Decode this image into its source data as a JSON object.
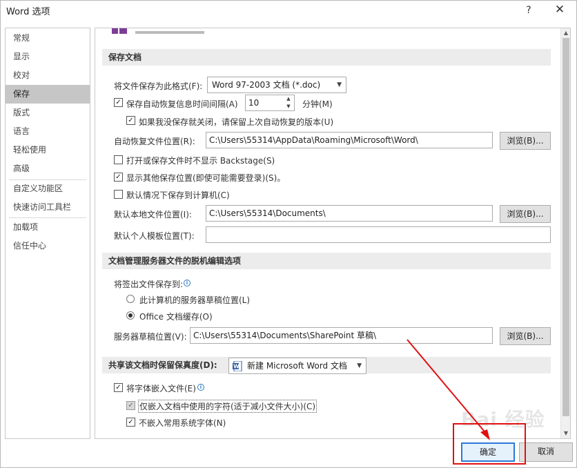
{
  "window": {
    "title": "Word 选项",
    "help_glyph": "?",
    "close_glyph": "✕"
  },
  "sidebar": {
    "items": [
      {
        "label": "常规"
      },
      {
        "label": "显示"
      },
      {
        "label": "校对"
      },
      {
        "label": "保存",
        "active": true
      },
      {
        "label": "版式"
      },
      {
        "label": "语言"
      },
      {
        "label": "轻松使用"
      },
      {
        "label": "高级"
      },
      {
        "label": "自定义功能区"
      },
      {
        "label": "快速访问工具栏"
      },
      {
        "label": "加载项"
      },
      {
        "label": "信任中心"
      }
    ]
  },
  "save_section": {
    "header": "保存文档",
    "format_label": "将文件保存为此格式(F):",
    "format_value": "Word 97-2003 文档 (*.doc)",
    "autorecover_label": "保存自动恢复信息时间间隔(A)",
    "autorecover_checked": true,
    "autorecover_value": "10",
    "minutes_label": "分钟(M)",
    "keep_last_label": "如果我没保存就关闭，请保留上次自动恢复的版本(U)",
    "keep_last_checked": true,
    "autorecover_location_label": "自动恢复文件位置(R):",
    "autorecover_location_value": "C:\\Users\\55314\\AppData\\Roaming\\Microsoft\\Word\\",
    "browse1": "浏览(B)...",
    "no_backstage_label": "打开或保存文件时不显示 Backstage(S)",
    "no_backstage_checked": false,
    "show_other_label": "显示其他保存位置(即使可能需要登录)(S)。",
    "show_other_checked": true,
    "save_to_computer_label": "默认情况下保存到计算机(C)",
    "save_to_computer_checked": false,
    "local_location_label": "默认本地文件位置(I):",
    "local_location_value": "C:\\Users\\55314\\Documents\\",
    "browse2": "浏览(B)...",
    "template_location_label": "默认个人模板位置(T):",
    "template_location_value": ""
  },
  "offline_section": {
    "header": "文档管理服务器文件的脱机编辑选项",
    "save_checked_out_label": "将签出文件保存到:",
    "radio1_label": "此计算机的服务器草稿位置(L)",
    "radio2_label": "Office 文档缓存(O)",
    "drafts_location_label": "服务器草稿位置(V):",
    "drafts_location_value": "C:\\Users\\55314\\Documents\\SharePoint 草稿\\",
    "browse3": "浏览(B)..."
  },
  "fidelity_section": {
    "header": "共享该文档时保留保真度(D):",
    "document_value": "新建 Microsoft Word 文档",
    "embed_fonts_label": "将字体嵌入文件(E)",
    "embed_fonts_checked": true,
    "embed_used_label": "仅嵌入文档中使用的字符(适于减小文件大小)(C)",
    "embed_used_checked": true,
    "no_common_label": "不嵌入常用系统字体(N)",
    "no_common_checked": true
  },
  "footer": {
    "ok": "确定",
    "cancel": "取消"
  },
  "annotation": {
    "color": "#e01010"
  },
  "watermark": "Bai 经验"
}
